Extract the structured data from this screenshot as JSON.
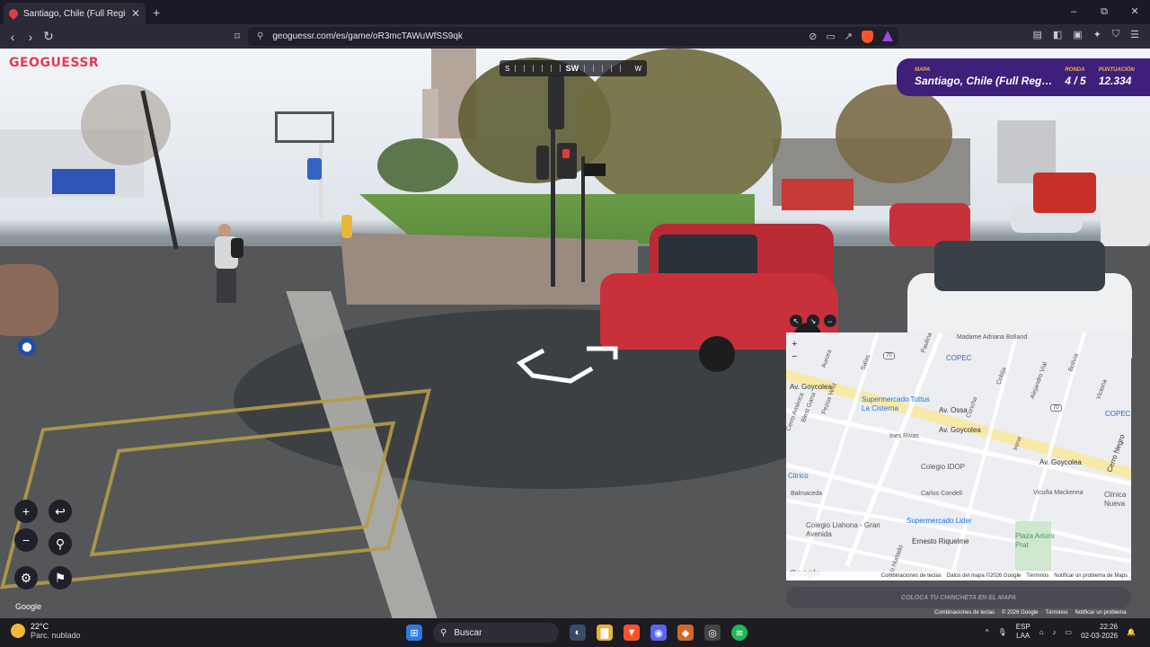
{
  "browser": {
    "tab_title": "Santiago, Chile (Full Region Met…",
    "url": "geoguessr.com/es/game/oR3mcTAWuWfSS9qk",
    "new_tab": "+",
    "window_controls": {
      "minimize": "–",
      "maximize": "⧉",
      "close": "✕"
    },
    "nav": {
      "back": "‹",
      "forward": "›",
      "reload": "↻"
    }
  },
  "game": {
    "logo": "GEOGUESSR",
    "compass": {
      "left": "S",
      "center": "SW",
      "right": "W"
    },
    "hud": {
      "map_label": "MAPA",
      "map_value": "Santiago, Chile (Full Reg…",
      "round_label": "RONDA",
      "round_value": "4 / 5",
      "score_label": "PUNTUACIÓN",
      "score_value": "12.334"
    },
    "guess_button": "COLOCA TU CHINCHETA EN EL MAPA",
    "google_sv": "Google",
    "sv_footer": [
      "Combinaciones de teclas",
      "© 2026 Google",
      "Términos",
      "Notificar un problema"
    ]
  },
  "map": {
    "streets": [
      "Madame Adriana Bolland",
      "Av. Goycolea",
      "Av. Ossa",
      "Av. Goycolea",
      "Av. Goycolea",
      "Ines Rivas",
      "Carlos Condell",
      "Vicuña Mackenna",
      "Ernesto Riquelme",
      "Balmaceda",
      "Aurora",
      "Salas",
      "Paulina",
      "Bolivia",
      "Victoria",
      "Cerro Negro",
      "Pezoa Veliz",
      "Blest Gana",
      "Cerro América",
      "Concha",
      "Cobija",
      "Alejandro Vial",
      "Irene",
      "Pedro Hurtado"
    ],
    "pois": [
      "COPEC",
      "Supermercado Tottus La Cisterna",
      "Colegio IDOP",
      "Citrico",
      "Supermercado Lider",
      "Colegio Liahona - Gran Avenida",
      "Plaza Arturo Prat",
      "COPEC",
      "Clínica Nueva"
    ],
    "route_badge": "70",
    "footer": [
      "Combinaciones de teclas",
      "Datos del mapa ©2026 Google",
      "Términos",
      "Notificar un problema de Maps"
    ],
    "google": "Google",
    "zoom_in": "+",
    "zoom_out": "−"
  },
  "taskbar": {
    "temp": "22°C",
    "weather": "Parc. nublado",
    "search": "Buscar",
    "lang1": "ESP",
    "lang2": "LAA",
    "time": "22:26",
    "date": "02-03-2026"
  },
  "colors": {
    "accent": "#3e1f7a",
    "gold": "#f3b23c",
    "brand_red": "#e5384f"
  }
}
